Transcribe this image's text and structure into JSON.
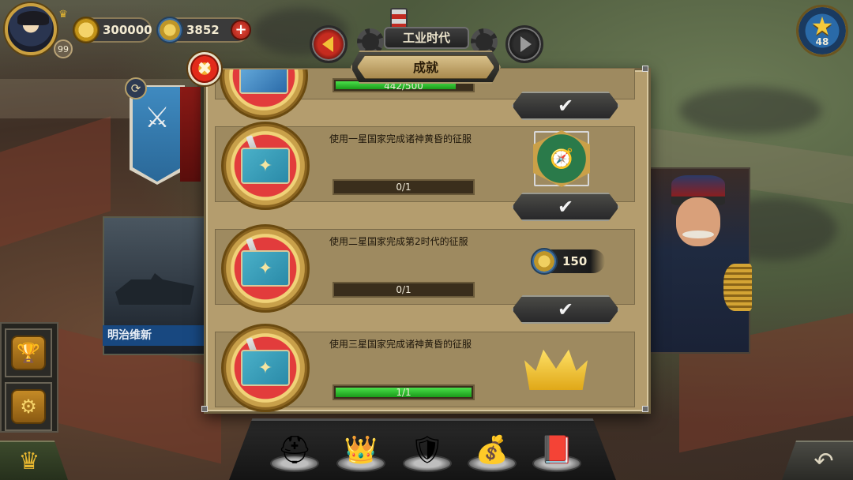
{
  "hud": {
    "player_level": "99",
    "gold": "300000",
    "medals": "3852",
    "plus_label": "+",
    "era_title": "工业时代",
    "stars": "48",
    "star_glyph": "★"
  },
  "left": {
    "refresh_glyph": "⟳",
    "banner_glyph": "⚔",
    "event_label": "明治维新",
    "trophy_glyph": "🏆",
    "settings_glyph": "⚙"
  },
  "modal": {
    "title": "成就",
    "close_glyph": "✖",
    "partial_row": {
      "progress_text": "442/500",
      "progress_fraction": 0.884,
      "claim_glyph": "✔"
    },
    "achievements": [
      {
        "title": "使用一星国家完成诸神黄昏的征服",
        "progress_text": "0/1",
        "progress_fraction": 0,
        "reward_type": "badge",
        "reward_icon": "compass-badge-icon",
        "reward_glyph": "🧭",
        "claim_glyph": "✔"
      },
      {
        "title": "使用二星国家完成第2时代的征服",
        "progress_text": "0/1",
        "progress_fraction": 0,
        "reward_type": "medals",
        "reward_icon": "medal-icon",
        "reward_value": "150",
        "claim_glyph": "✔"
      },
      {
        "title": "使用三星国家完成诸神黄昏的征服",
        "progress_text": "1/1",
        "progress_fraction": 1,
        "reward_type": "crown",
        "reward_icon": "crown-icon"
      }
    ],
    "medallion_icon": "map-compass-icon",
    "medallion_glyph": "✦"
  },
  "bottom": {
    "crown_glyph": "♛",
    "back_glyph": "↶",
    "items": [
      {
        "name": "spartan-helmet-icon",
        "glyph": "⛑"
      },
      {
        "name": "tiara-icon",
        "glyph": "👑"
      },
      {
        "name": "shield-sword-icon",
        "glyph": "🛡"
      },
      {
        "name": "treasure-chest-icon",
        "glyph": "💰"
      },
      {
        "name": "book-icon",
        "glyph": "📕"
      }
    ]
  },
  "colors": {
    "accent_gold": "#caa040",
    "progress_green": "#3ec83e",
    "modal_bg": "#b49d6e",
    "row_bg": "#9e8a60"
  }
}
